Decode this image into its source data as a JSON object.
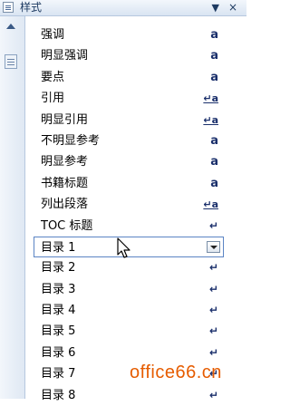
{
  "panel": {
    "title": "样式",
    "menu_arrow": "▼",
    "close": "×"
  },
  "styles": [
    {
      "label": "强调",
      "indicator": "a",
      "kind": "char"
    },
    {
      "label": "明显强调",
      "indicator": "a",
      "kind": "char"
    },
    {
      "label": "要点",
      "indicator": "a",
      "kind": "char"
    },
    {
      "label": "引用",
      "indicator": "↵a",
      "kind": "linked"
    },
    {
      "label": "明显引用",
      "indicator": "↵a",
      "kind": "linked"
    },
    {
      "label": "不明显参考",
      "indicator": "a",
      "kind": "char"
    },
    {
      "label": "明显参考",
      "indicator": "a",
      "kind": "char"
    },
    {
      "label": "书籍标题",
      "indicator": "a",
      "kind": "char"
    },
    {
      "label": "列出段落",
      "indicator": "↵a",
      "kind": "linked"
    },
    {
      "label": "TOC 标题",
      "indicator": "↵",
      "kind": "para"
    },
    {
      "label": "目录 1",
      "indicator": "",
      "kind": "selected"
    },
    {
      "label": "目录 2",
      "indicator": "↵",
      "kind": "para"
    },
    {
      "label": "目录 3",
      "indicator": "↵",
      "kind": "para"
    },
    {
      "label": "目录 4",
      "indicator": "↵",
      "kind": "para"
    },
    {
      "label": "目录 5",
      "indicator": "↵",
      "kind": "para"
    },
    {
      "label": "目录 6",
      "indicator": "↵",
      "kind": "para"
    },
    {
      "label": "目录 7",
      "indicator": "↵",
      "kind": "para"
    },
    {
      "label": "目录 8",
      "indicator": "↵",
      "kind": "para"
    }
  ],
  "watermark": "office66.cn",
  "colors": {
    "indicator": "#1a2f6b",
    "selection_border": "#5b84c4",
    "watermark": "#e65c00"
  }
}
